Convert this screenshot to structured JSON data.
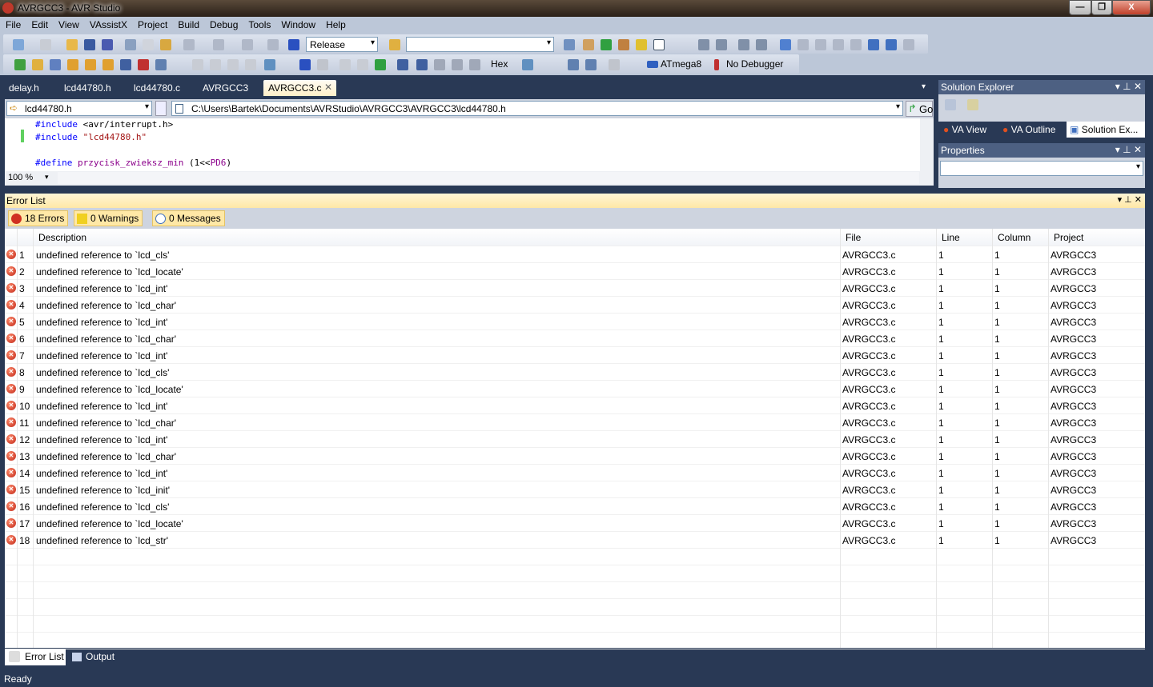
{
  "window": {
    "title": "AVRGCC3 - AVR Studio",
    "minimize": "—",
    "restore": "❐",
    "close": "X"
  },
  "menu": [
    "File",
    "Edit",
    "View",
    "VAssistX",
    "Project",
    "Build",
    "Debug",
    "Tools",
    "Window",
    "Help"
  ],
  "toolbar": {
    "configuration": "Release",
    "platform": "",
    "hex_label": "Hex",
    "device": "ATmega8",
    "debugger": "No Debugger"
  },
  "doc_tabs": [
    "delay.h",
    "lcd44780.h",
    "lcd44780.c",
    "AVRGCC3",
    "AVRGCC3.c"
  ],
  "editor": {
    "file_combo": "lcd44780.h",
    "path": "C:\\Users\\Bartek\\Documents\\AVRStudio\\AVRGCC3\\AVRGCC3\\lcd44780.h",
    "go_label": "Go",
    "zoom": "100 %",
    "lines": [
      {
        "kw": "#include",
        "rest": " <avr/interrupt.h>"
      },
      {
        "kw": "#include",
        "str": " \"lcd44780.h\""
      },
      {
        "kw": "#define",
        "mac": " przycisk_zwieksz_min",
        "rest": " (1<<",
        "mac2": "PD6",
        "end": ")"
      }
    ]
  },
  "solution_explorer": {
    "title": "Solution Explorer",
    "tabs": [
      "VA View",
      "VA Outline",
      "Solution Ex..."
    ]
  },
  "properties": {
    "title": "Properties"
  },
  "error_list": {
    "title": "Error List",
    "filters": {
      "errors": "18 Errors",
      "warnings": "0 Warnings",
      "messages": "0 Messages"
    },
    "columns": [
      "Description",
      "File",
      "Line",
      "Column",
      "Project"
    ],
    "rows": [
      {
        "n": "1",
        "desc": "undefined reference to `lcd_cls'",
        "file": "AVRGCC3.c",
        "line": "1",
        "col": "1",
        "proj": "AVRGCC3"
      },
      {
        "n": "2",
        "desc": "undefined reference to `lcd_locate'",
        "file": "AVRGCC3.c",
        "line": "1",
        "col": "1",
        "proj": "AVRGCC3"
      },
      {
        "n": "3",
        "desc": "undefined reference to `lcd_int'",
        "file": "AVRGCC3.c",
        "line": "1",
        "col": "1",
        "proj": "AVRGCC3"
      },
      {
        "n": "4",
        "desc": "undefined reference to `lcd_char'",
        "file": "AVRGCC3.c",
        "line": "1",
        "col": "1",
        "proj": "AVRGCC3"
      },
      {
        "n": "5",
        "desc": "undefined reference to `lcd_int'",
        "file": "AVRGCC3.c",
        "line": "1",
        "col": "1",
        "proj": "AVRGCC3"
      },
      {
        "n": "6",
        "desc": "undefined reference to `lcd_char'",
        "file": "AVRGCC3.c",
        "line": "1",
        "col": "1",
        "proj": "AVRGCC3"
      },
      {
        "n": "7",
        "desc": "undefined reference to `lcd_int'",
        "file": "AVRGCC3.c",
        "line": "1",
        "col": "1",
        "proj": "AVRGCC3"
      },
      {
        "n": "8",
        "desc": "undefined reference to `lcd_cls'",
        "file": "AVRGCC3.c",
        "line": "1",
        "col": "1",
        "proj": "AVRGCC3"
      },
      {
        "n": "9",
        "desc": "undefined reference to `lcd_locate'",
        "file": "AVRGCC3.c",
        "line": "1",
        "col": "1",
        "proj": "AVRGCC3"
      },
      {
        "n": "10",
        "desc": "undefined reference to `lcd_int'",
        "file": "AVRGCC3.c",
        "line": "1",
        "col": "1",
        "proj": "AVRGCC3"
      },
      {
        "n": "11",
        "desc": "undefined reference to `lcd_char'",
        "file": "AVRGCC3.c",
        "line": "1",
        "col": "1",
        "proj": "AVRGCC3"
      },
      {
        "n": "12",
        "desc": "undefined reference to `lcd_int'",
        "file": "AVRGCC3.c",
        "line": "1",
        "col": "1",
        "proj": "AVRGCC3"
      },
      {
        "n": "13",
        "desc": "undefined reference to `lcd_char'",
        "file": "AVRGCC3.c",
        "line": "1",
        "col": "1",
        "proj": "AVRGCC3"
      },
      {
        "n": "14",
        "desc": "undefined reference to `lcd_int'",
        "file": "AVRGCC3.c",
        "line": "1",
        "col": "1",
        "proj": "AVRGCC3"
      },
      {
        "n": "15",
        "desc": "undefined reference to `lcd_init'",
        "file": "AVRGCC3.c",
        "line": "1",
        "col": "1",
        "proj": "AVRGCC3"
      },
      {
        "n": "16",
        "desc": "undefined reference to `lcd_cls'",
        "file": "AVRGCC3.c",
        "line": "1",
        "col": "1",
        "proj": "AVRGCC3"
      },
      {
        "n": "17",
        "desc": "undefined reference to `lcd_locate'",
        "file": "AVRGCC3.c",
        "line": "1",
        "col": "1",
        "proj": "AVRGCC3"
      },
      {
        "n": "18",
        "desc": "undefined reference to `lcd_str'",
        "file": "AVRGCC3.c",
        "line": "1",
        "col": "1",
        "proj": "AVRGCC3"
      }
    ]
  },
  "bottom_tabs": [
    "Error List",
    "Output"
  ],
  "status": "Ready"
}
